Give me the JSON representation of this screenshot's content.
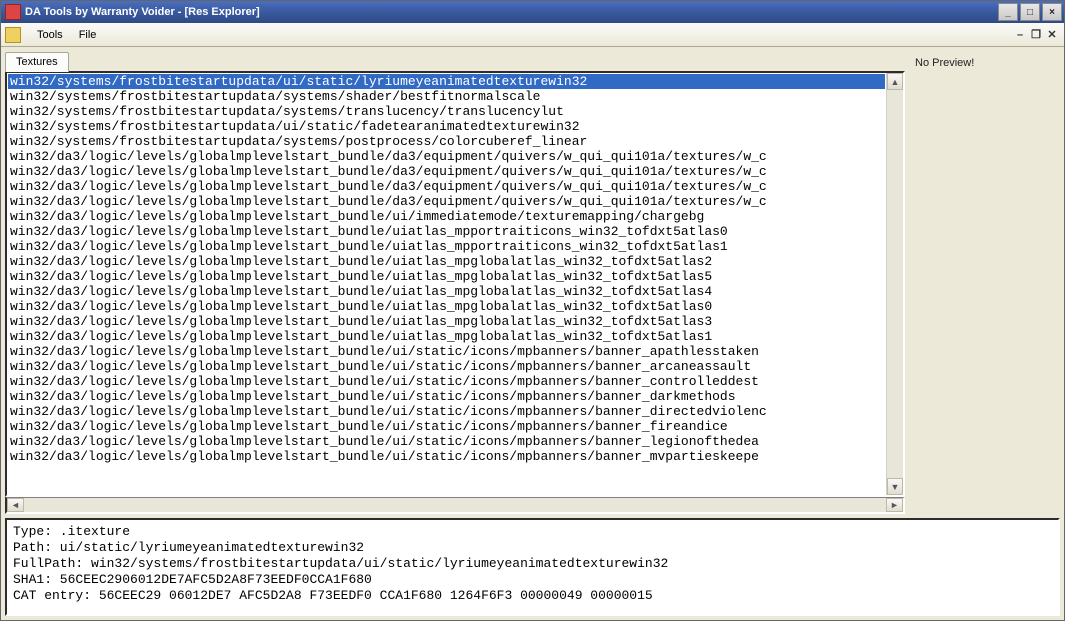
{
  "window": {
    "title": "DA Tools by Warranty Voider - [Res Explorer]"
  },
  "menubar": {
    "items": [
      "Tools",
      "File"
    ]
  },
  "tabs": {
    "active": "Textures"
  },
  "preview": {
    "text": "No Preview!"
  },
  "list": {
    "selectedIndex": 0,
    "items": [
      "win32/systems/frostbitestartupdata/ui/static/lyriumeyeanimatedtexturewin32",
      "win32/systems/frostbitestartupdata/systems/shader/bestfitnormalscale",
      "win32/systems/frostbitestartupdata/systems/translucency/translucencylut",
      "win32/systems/frostbitestartupdata/ui/static/fadetearanimatedtexturewin32",
      "win32/systems/frostbitestartupdata/systems/postprocess/colorcuberef_linear",
      "win32/da3/logic/levels/globalmplevelstart_bundle/da3/equipment/quivers/w_qui_qui101a/textures/w_c",
      "win32/da3/logic/levels/globalmplevelstart_bundle/da3/equipment/quivers/w_qui_qui101a/textures/w_c",
      "win32/da3/logic/levels/globalmplevelstart_bundle/da3/equipment/quivers/w_qui_qui101a/textures/w_c",
      "win32/da3/logic/levels/globalmplevelstart_bundle/da3/equipment/quivers/w_qui_qui101a/textures/w_c",
      "win32/da3/logic/levels/globalmplevelstart_bundle/ui/immediatemode/texturemapping/chargebg",
      "win32/da3/logic/levels/globalmplevelstart_bundle/uiatlas_mpportraiticons_win32_tofdxt5atlas0",
      "win32/da3/logic/levels/globalmplevelstart_bundle/uiatlas_mpportraiticons_win32_tofdxt5atlas1",
      "win32/da3/logic/levels/globalmplevelstart_bundle/uiatlas_mpglobalatlas_win32_tofdxt5atlas2",
      "win32/da3/logic/levels/globalmplevelstart_bundle/uiatlas_mpglobalatlas_win32_tofdxt5atlas5",
      "win32/da3/logic/levels/globalmplevelstart_bundle/uiatlas_mpglobalatlas_win32_tofdxt5atlas4",
      "win32/da3/logic/levels/globalmplevelstart_bundle/uiatlas_mpglobalatlas_win32_tofdxt5atlas0",
      "win32/da3/logic/levels/globalmplevelstart_bundle/uiatlas_mpglobalatlas_win32_tofdxt5atlas3",
      "win32/da3/logic/levels/globalmplevelstart_bundle/uiatlas_mpglobalatlas_win32_tofdxt5atlas1",
      "win32/da3/logic/levels/globalmplevelstart_bundle/ui/static/icons/mpbanners/banner_apathlesstaken",
      "win32/da3/logic/levels/globalmplevelstart_bundle/ui/static/icons/mpbanners/banner_arcaneassault",
      "win32/da3/logic/levels/globalmplevelstart_bundle/ui/static/icons/mpbanners/banner_controlleddest",
      "win32/da3/logic/levels/globalmplevelstart_bundle/ui/static/icons/mpbanners/banner_darkmethods",
      "win32/da3/logic/levels/globalmplevelstart_bundle/ui/static/icons/mpbanners/banner_directedviolenc",
      "win32/da3/logic/levels/globalmplevelstart_bundle/ui/static/icons/mpbanners/banner_fireandice",
      "win32/da3/logic/levels/globalmplevelstart_bundle/ui/static/icons/mpbanners/banner_legionofthedea",
      "win32/da3/logic/levels/globalmplevelstart_bundle/ui/static/icons/mpbanners/banner_mvpartieskeepe"
    ]
  },
  "details": {
    "type": "Type: .itexture",
    "path": "Path: ui/static/lyriumeyeanimatedtexturewin32",
    "fullpath": "FullPath: win32/systems/frostbitestartupdata/ui/static/lyriumeyeanimatedtexturewin32",
    "sha1": "SHA1: 56CEEC2906012DE7AFC5D2A8F73EEDF0CCA1F680",
    "cat": "CAT entry: 56CEEC29 06012DE7 AFC5D2A8 F73EEDF0 CCA1F680 1264F6F3 00000049 00000015"
  }
}
